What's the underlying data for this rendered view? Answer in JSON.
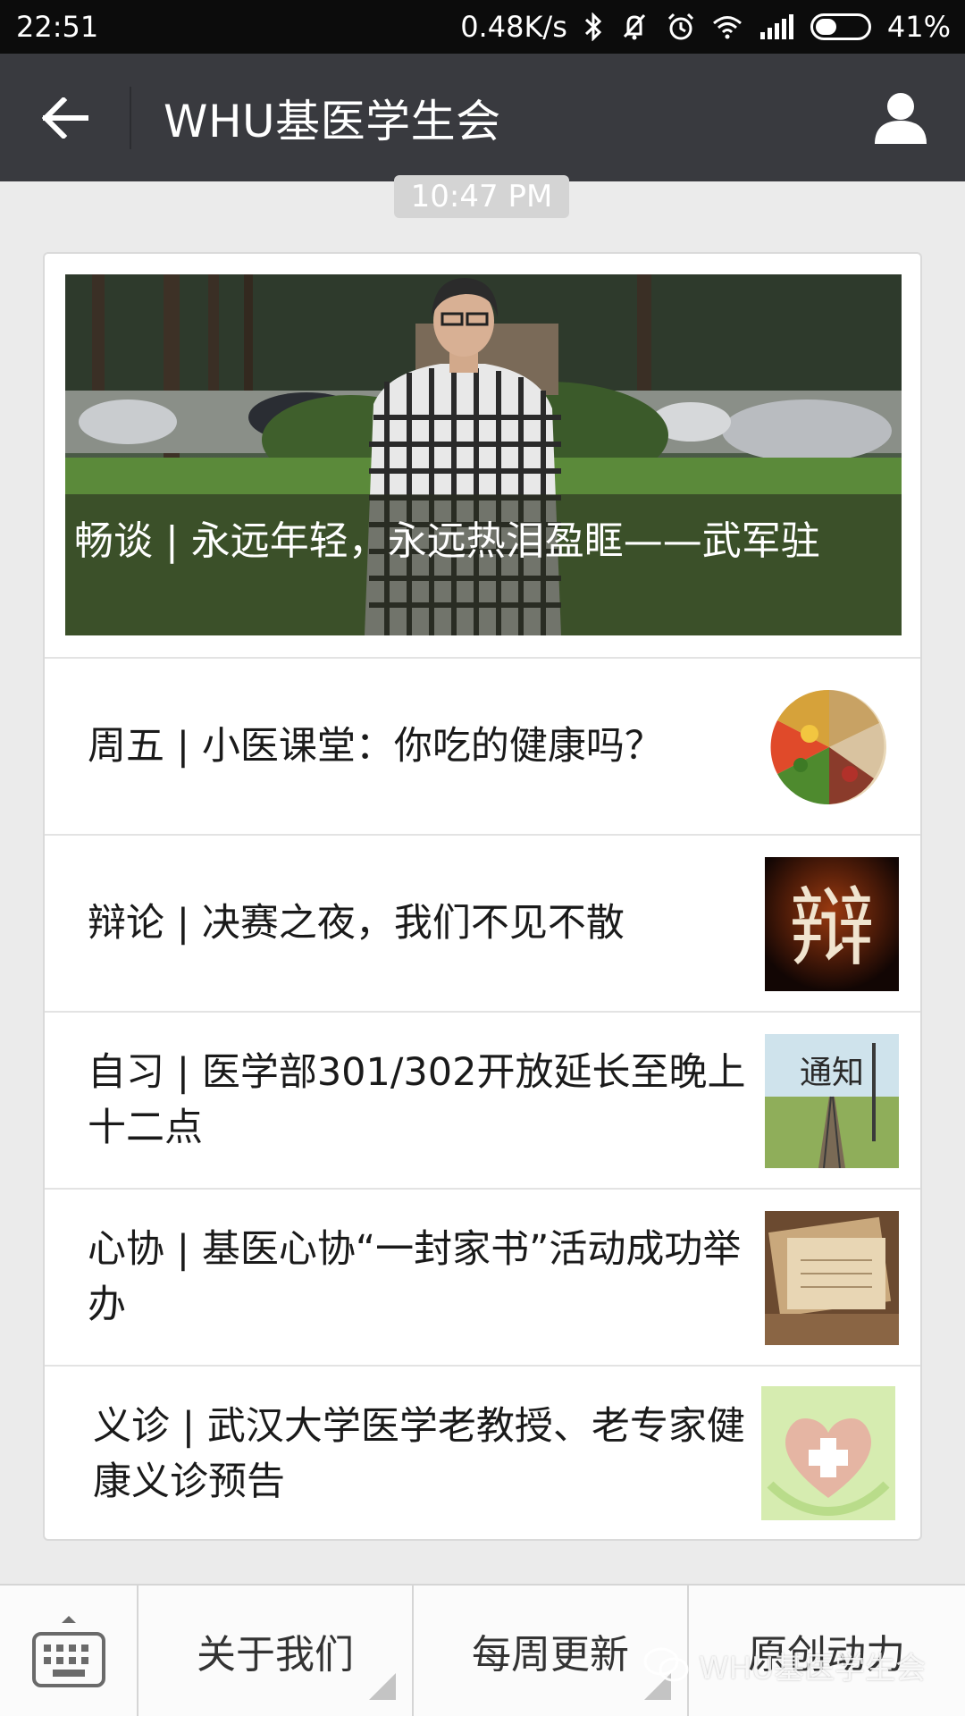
{
  "status_bar": {
    "time": "22:51",
    "net_speed": "0.48K/s",
    "battery_percent": "41%",
    "battery_level": 0.41,
    "icons": [
      "bluetooth-icon",
      "mute-icon",
      "alarm-icon",
      "wifi-icon",
      "signal-icon",
      "battery-icon"
    ]
  },
  "header": {
    "title": "WHU基医学生会",
    "back_icon": "arrow-left-icon",
    "profile_icon": "person-icon"
  },
  "chat": {
    "timestamp": "10:47 PM"
  },
  "articles": {
    "cover": {
      "title": "畅谈 | 永远年轻，永远热泪盈眶——武军驻"
    },
    "items": [
      {
        "title": "周五 | 小医课堂：你吃的健康吗？",
        "thumb": "food-plate-image"
      },
      {
        "title": "辩论 | 决赛之夜，我们不见不散",
        "thumb": "debate-calligraphy-image",
        "thumb_text": "辩"
      },
      {
        "title": "自习 | 医学部301/302开放延长至晚上十二点",
        "thumb": "notice-railway-image",
        "thumb_text": "通知"
      },
      {
        "title": "心协 | 基医心协“一封家书”活动成功举办",
        "thumb": "letters-image"
      },
      {
        "title": "义诊 | 武汉大学医学老教授、老专家健康义诊预告",
        "thumb": "medical-heart-image"
      }
    ]
  },
  "bottom_menu": {
    "keyboard_icon": "keyboard-icon",
    "items": [
      "关于我们",
      "每周更新",
      "原创动力"
    ]
  },
  "watermark": {
    "text": "WHU基医学生会",
    "icon": "wechat-icon"
  },
  "colors": {
    "header_bg": "#393a3f",
    "status_bg": "#0c0c0c",
    "page_bg": "#ebebeb",
    "card_bg": "#ffffff"
  }
}
